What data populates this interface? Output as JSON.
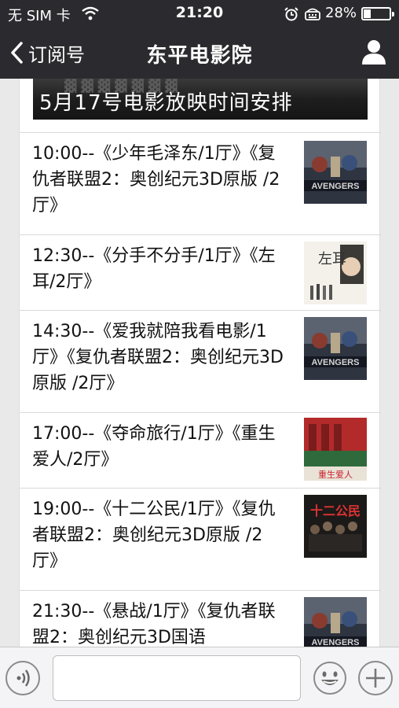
{
  "status_bar": {
    "carrier": "无 SIM 卡",
    "time": "21:20",
    "battery_percent": "28%",
    "battery_level": 0.28,
    "icons": [
      "wifi-icon",
      "alarm-icon",
      "tty-icon",
      "battery-icon"
    ]
  },
  "nav": {
    "back_label": "订阅号",
    "title": "东平电影院",
    "profile_icon": "person-icon"
  },
  "banner": {
    "title": "5月17号电影放映时间安排"
  },
  "schedule": [
    {
      "text": "10:00--《少年毛泽东/1厅》《复仇者联盟2：奥创纪元3D原版 /2厅》",
      "thumb": "avengers-poster"
    },
    {
      "text": "12:30--《分手不分手/1厅》《左耳/2厅》",
      "thumb": "zuoer-poster"
    },
    {
      "text": "14:30--《爱我就陪我看电影/1厅》《复仇者联盟2：奥创纪元3D原版 /2厅》",
      "thumb": "avengers-poster"
    },
    {
      "text": "17:00--《夺命旅行/1厅》《重生爱人/2厅》",
      "thumb": "chongsheng-poster"
    },
    {
      "text": "19:00--《十二公民/1厅》《复仇者联盟2：奥创纪元3D原版 /2厅》",
      "thumb": "twelve-citizens-poster"
    },
    {
      "text": "21:30--《悬战/1厅》《复仇者联盟2：奥创纪元3D国语",
      "thumb": "avengers-poster"
    }
  ],
  "poster_text": {
    "avengers": "AVENGERS",
    "zuoer": "左耳",
    "chongsheng": "重生爱人",
    "twelve": "十二公民"
  },
  "bottom_bar": {
    "input_value": "",
    "icons": [
      "voice-icon",
      "emoji-icon",
      "plus-icon"
    ]
  },
  "colors": {
    "bar_bg": "#2b2b2f",
    "page_bg": "#e9e9e9",
    "card_bg": "#ffffff"
  }
}
